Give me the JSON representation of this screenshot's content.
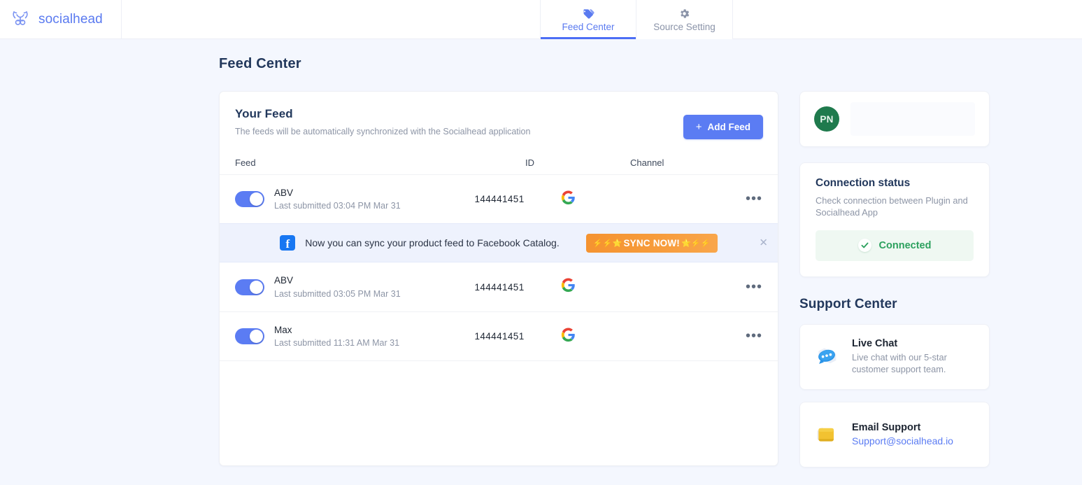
{
  "brand": {
    "name": "socialhead",
    "logo_icon": "antler-logo-icon"
  },
  "tabs": [
    {
      "label": "Feed Center",
      "icon": "tag-icon",
      "active": true
    },
    {
      "label": "Source Setting",
      "icon": "gear-icon",
      "active": false
    }
  ],
  "page": {
    "title": "Feed Center"
  },
  "feed_card": {
    "heading": "Your Feed",
    "subheading": "The feeds will be automatically synchronized with the Socialhead application",
    "add_button": {
      "label": "Add Feed",
      "plus": "+"
    },
    "columns": {
      "feed": "Feed",
      "id": "ID",
      "channel": "Channel"
    },
    "rows": [
      {
        "name": "ABV",
        "submitted": "Last submitted 03:04 PM Mar 31",
        "id": "144441451",
        "channel_icon": "google-icon",
        "toggle_on": true,
        "menu": "•••"
      },
      {
        "name": "ABV",
        "submitted": "Last submitted 03:05 PM Mar 31",
        "id": "144441451",
        "channel_icon": "google-icon",
        "toggle_on": true,
        "menu": "•••"
      },
      {
        "name": "Max",
        "submitted": "Last submitted 11:31 AM Mar 31",
        "id": "144441451",
        "channel_icon": "google-icon",
        "toggle_on": true,
        "menu": "•••"
      }
    ],
    "banner": {
      "icon": "facebook-icon",
      "letter": "f",
      "text": "Now you can sync your product feed to Facebook Catalog.",
      "button_prefix": "⚡⚡⭐",
      "button_label": "SYNC NOW!",
      "button_suffix": "⭐⚡⚡",
      "close": "✕",
      "accent_color": "#f79b3a"
    }
  },
  "rail": {
    "user": {
      "initials": "PN"
    },
    "connection": {
      "title": "Connection status",
      "description": "Check connection between Plugin and Socialhead App",
      "status_label": "Connected",
      "status_color": "#2ca15e",
      "check_icon": "check-icon"
    },
    "support": {
      "title": "Support Center",
      "items": [
        {
          "title": "Live Chat",
          "description": "Live chat with our 5-star customer support team.",
          "icon": "chat-bubble-icon"
        },
        {
          "title": "Email Support",
          "email": "Support@socialhead.io",
          "icon": "envelope-icon"
        }
      ]
    }
  },
  "colors": {
    "accent": "#5b7cf3",
    "page_bg": "#f4f7fe",
    "heading": "#22385c",
    "success": "#2ca15e",
    "orange": "#f79b3a"
  }
}
